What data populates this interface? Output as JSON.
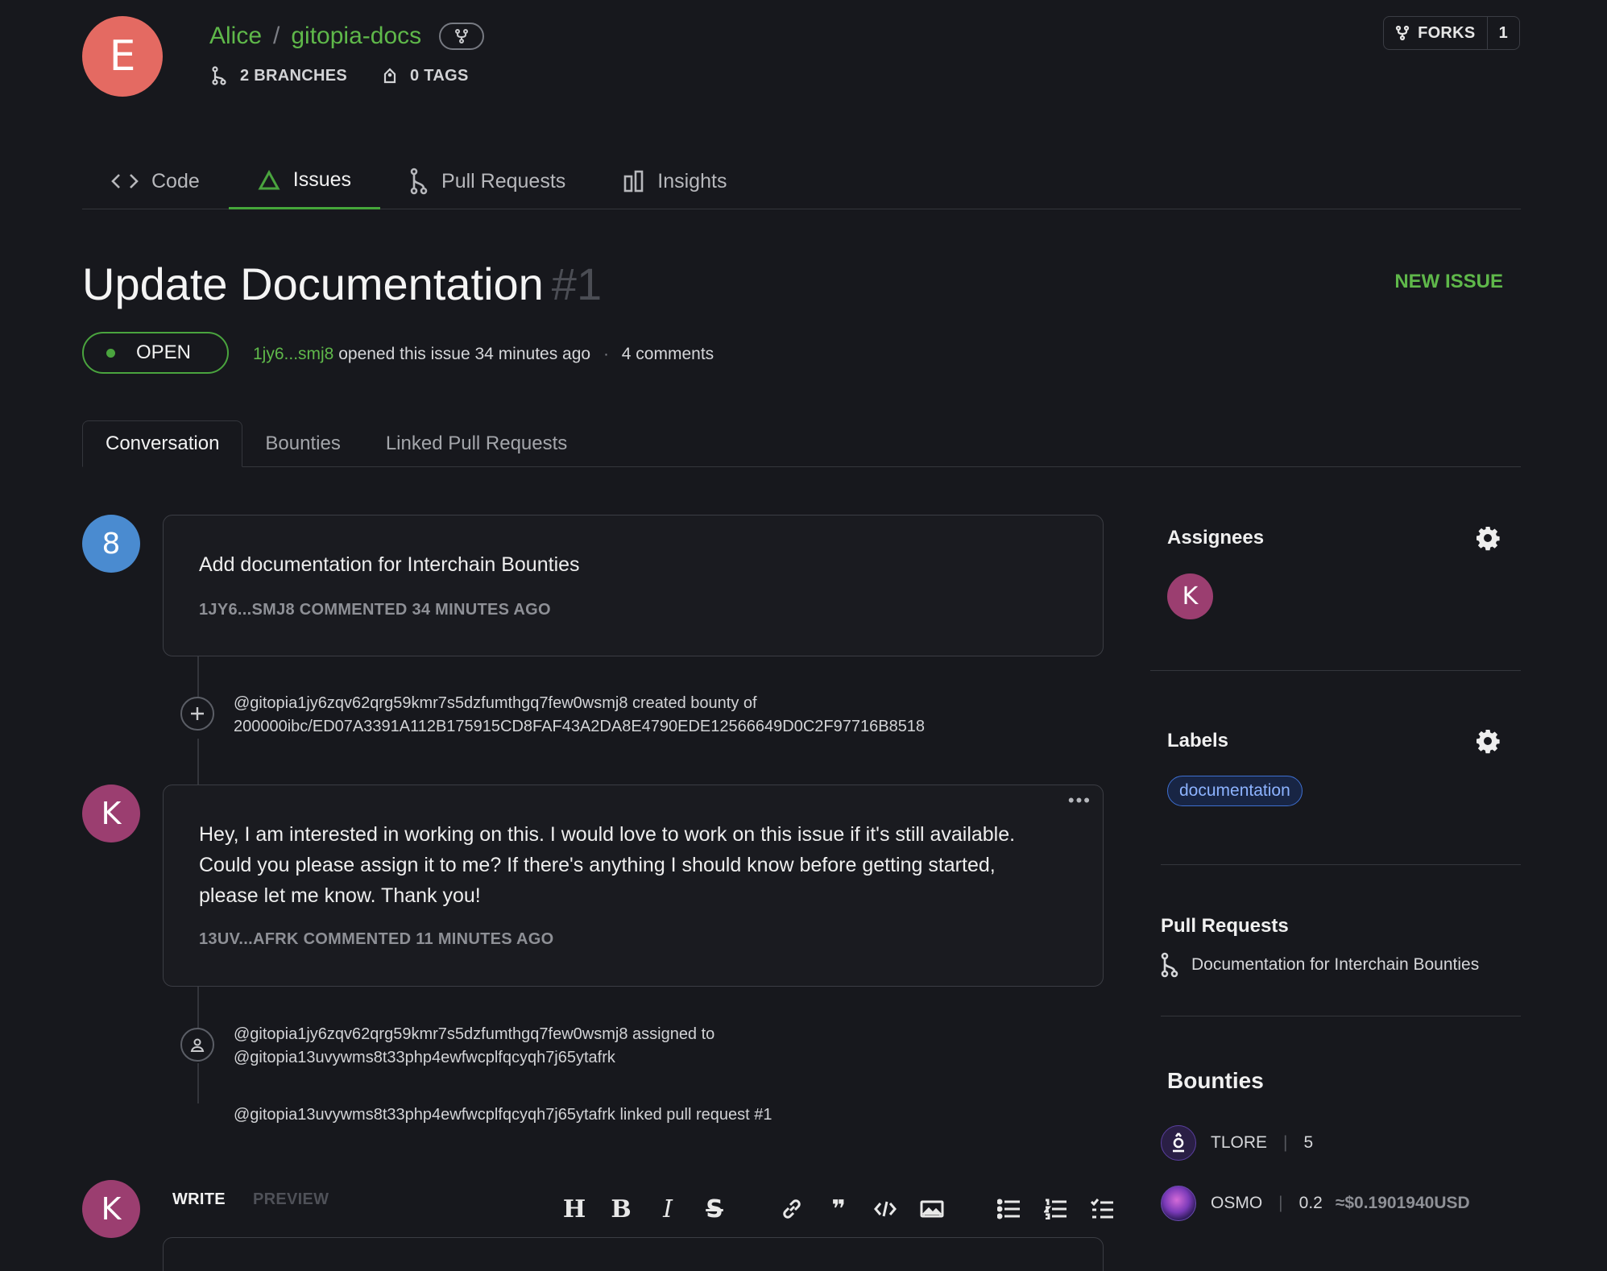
{
  "repo": {
    "avatar_letter": "E",
    "owner": "Alice",
    "separator": "/",
    "name": "gitopia-docs",
    "branches": "2 BRANCHES",
    "tags": "0 TAGS",
    "forks_label": "FORKS",
    "forks_count": "1"
  },
  "nav": {
    "tabs": [
      {
        "label": "Code",
        "icon": "code-icon"
      },
      {
        "label": "Issues",
        "icon": "issue-icon",
        "active": true
      },
      {
        "label": "Pull Requests",
        "icon": "pull-request-icon"
      },
      {
        "label": "Insights",
        "icon": "insights-icon"
      }
    ]
  },
  "issue": {
    "title": "Update Documentation",
    "number": "#1",
    "new_issue_label": "NEW ISSUE",
    "status": "OPEN",
    "author": "1jy6...smj8",
    "opened_text": "opened this issue 34 minutes ago",
    "dot": "·",
    "comments_count": "4 comments"
  },
  "subtabs": [
    "Conversation",
    "Bounties",
    "Linked Pull Requests"
  ],
  "timeline": {
    "comment1": {
      "avatar_letter": "8",
      "body": "Add documentation for Interchain Bounties",
      "meta": "1JY6...SMJ8 COMMENTED 34 MINUTES AGO"
    },
    "event_bounty": {
      "line1": "@gitopia1jy6zqv62qrg59kmr7s5dzfumthgq7few0wsmj8 created bounty of",
      "line2": "200000ibc/ED07A3391A112B175915CD8FAF43A2DA8E4790EDE12566649D0C2F97716B8518"
    },
    "comment2": {
      "avatar_letter": "K",
      "body_line1": "Hey, I am interested in working on this. I would love to work on this issue if it's still available.",
      "body_line2": "Could you please assign it to me? If there's anything I should know before getting started,",
      "body_line3": "please let me know. Thank you!",
      "meta": "13UV...AFRK COMMENTED 11 MINUTES AGO",
      "menu": "•••"
    },
    "event_assign": {
      "line1": "@gitopia1jy6zqv62qrg59kmr7s5dzfumthgq7few0wsmj8 assigned to",
      "line2": "@gitopia13uvywms8t33php4ewfwcplfqcyqh7j65ytafrk"
    },
    "event_link": {
      "line1": "@gitopia13uvywms8t33php4ewfwcplfqcyqh7j65ytafrk linked pull request #1"
    }
  },
  "editor": {
    "avatar_letter": "K",
    "write_tab": "WRITE",
    "preview_tab": "PREVIEW",
    "toolbar": [
      "heading",
      "bold",
      "italic",
      "strikethrough",
      "link",
      "quote",
      "code",
      "image",
      "unordered-list",
      "ordered-list",
      "task-list"
    ],
    "toolbar_glyphs": {
      "heading": "H",
      "bold": "B",
      "italic": "I",
      "strikethrough": "S",
      "quote": "❞"
    }
  },
  "sidebar": {
    "assignees_title": "Assignees",
    "assignee_letter": "K",
    "labels_title": "Labels",
    "label": "documentation",
    "pull_requests_title": "Pull Requests",
    "pull_request": "Documentation for Interchain Bounties",
    "bounties_title": "Bounties",
    "bounties": [
      {
        "token": "TLORE",
        "amount": "5",
        "usd": ""
      },
      {
        "token": "OSMO",
        "amount": "0.2",
        "usd": "≈$0.1901940USD"
      }
    ],
    "bounty_sep": "|"
  },
  "colors": {
    "background": "#17181d",
    "accent_green": "#5fb84a",
    "repo_avatar": "#e46a62",
    "avatar_8": "#4a8bd0",
    "avatar_k": "#9b3e70",
    "label_blue": "#8db3ff"
  }
}
